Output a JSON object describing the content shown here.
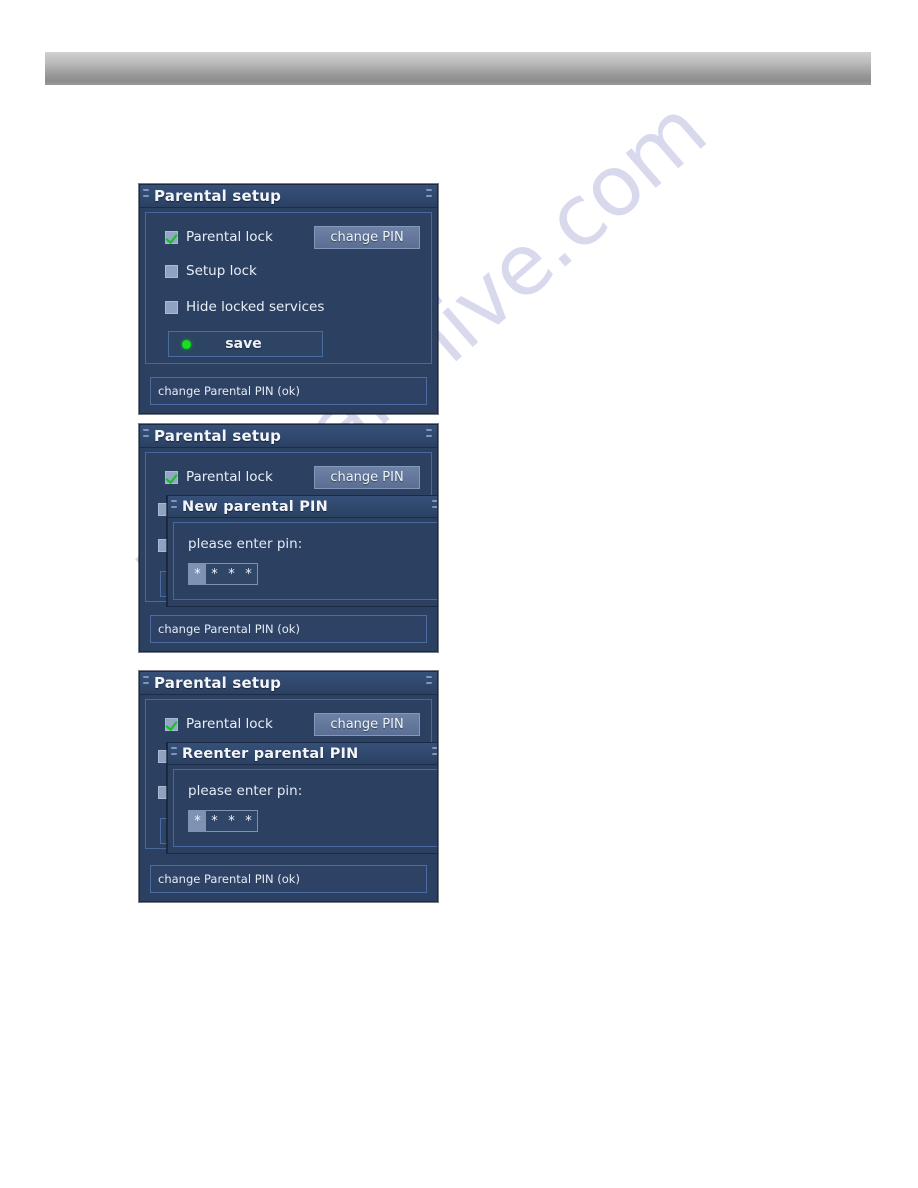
{
  "page": {
    "background": "#ffffff",
    "watermark_text": "Manualshive.com",
    "top_band_color": "#a9a9a9"
  },
  "colors": {
    "panel_bg": "#2c4161",
    "panel_border": "#1b2a42",
    "titlebar_bg": "#30486d",
    "accent_green": "#14e01c",
    "checkbox_fill": "#8fa3c0",
    "button_bg": "#63789c",
    "text": "#e8edf5"
  },
  "panels": [
    {
      "title": "Parental setup",
      "checkboxes": [
        {
          "label": "Parental lock",
          "checked": true
        },
        {
          "label": "Setup lock",
          "checked": false
        },
        {
          "label": "Hide locked services",
          "checked": false
        }
      ],
      "change_pin_button": "change PIN",
      "save_button": "save",
      "status_text": "change Parental PIN (ok)"
    },
    {
      "title": "Parental setup",
      "checkboxes": [
        {
          "label": "Parental lock",
          "checked": true
        }
      ],
      "change_pin_button": "change PIN",
      "subdialog": {
        "title": "New parental PIN",
        "prompt": "please enter pin:",
        "pin_cells": [
          "*",
          "*",
          "*",
          "*"
        ],
        "cursor_index": 0
      },
      "status_text": "change Parental PIN (ok)"
    },
    {
      "title": "Parental setup",
      "checkboxes": [
        {
          "label": "Parental lock",
          "checked": true
        }
      ],
      "change_pin_button": "change PIN",
      "subdialog": {
        "title": "Reenter parental PIN",
        "prompt": "please enter pin:",
        "pin_cells": [
          "*",
          "*",
          "*",
          "*"
        ],
        "cursor_index": 0
      },
      "status_text": "change Parental PIN (ok)"
    }
  ],
  "icons": {
    "scroll_arrows_left": "scroll-arrows-left-icon",
    "scroll_arrows_right": "scroll-arrows-right-icon",
    "checkmark": "checkmark-icon",
    "status_dot": "green-status-dot-icon"
  }
}
